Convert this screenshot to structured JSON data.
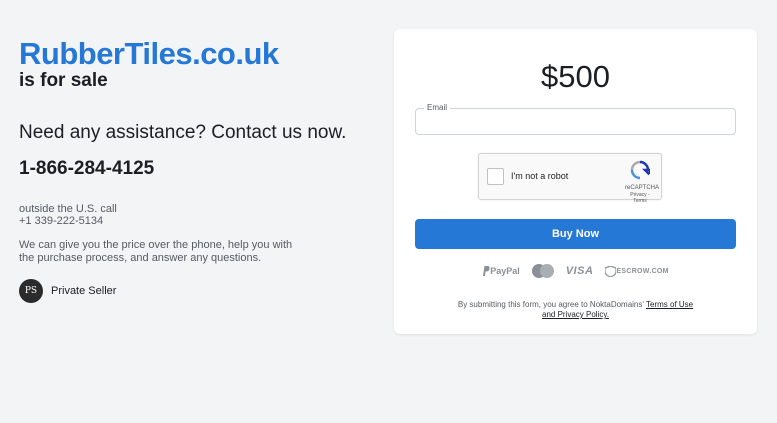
{
  "domain": "RubberTiles.co.uk",
  "for_sale": "is for sale",
  "assist_text": "Need any assistance? Contact us now.",
  "phone": "1-866-284-4125",
  "outside_us": "outside the U.S. call",
  "alt_phone": "+1 339-222-5134",
  "description": "We can give you the price over the phone, help you with the purchase process, and answer any questions.",
  "seller": {
    "initials": "PS",
    "name": "Private Seller"
  },
  "form": {
    "price": "$500",
    "email_label": "Email",
    "email_value": "",
    "captcha_label": "I'm not a robot",
    "captcha_brand": "reCAPTCHA",
    "captcha_terms": "Privacy - Terms",
    "buy_label": "Buy Now",
    "payments": {
      "paypal": "PayPal",
      "mastercard": "mastercard",
      "visa": "VISA",
      "escrow": "ESCROW.COM"
    },
    "terms_prefix": "By submitting this form, you agree to NoktaDomains'",
    "terms_link": "Terms of Use and Privacy Policy."
  },
  "colors": {
    "accent": "#2678d6",
    "background": "#f2f4f6"
  }
}
